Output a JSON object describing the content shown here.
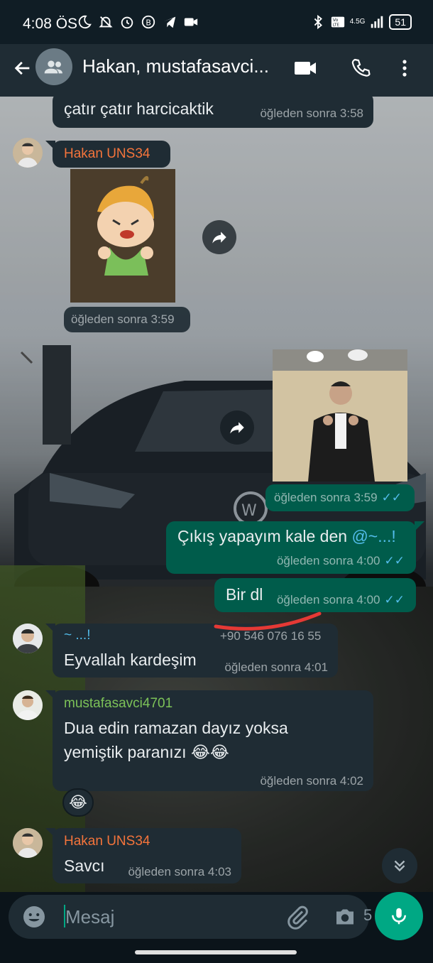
{
  "status_bar": {
    "time": "4:08 ÖS",
    "network": "4.5G",
    "battery": "51"
  },
  "header": {
    "title": "Hakan, mustafasavci..."
  },
  "messages": [
    {
      "id": "m0",
      "direction": "in",
      "text": "çatır çatır harcicaktik",
      "time": "öğleden sonra 3:58"
    },
    {
      "id": "m1",
      "direction": "in",
      "sender": "Hakan UNS34",
      "sender_color": "#f4743b",
      "type": "sticker",
      "time": "öğleden sonra 3:59"
    },
    {
      "id": "m2",
      "direction": "out",
      "type": "sticker",
      "time": "öğleden sonra 3:59",
      "read": true
    },
    {
      "id": "m3",
      "direction": "out",
      "text": "Çıkış yapayım kale den",
      "mention": "@~...!",
      "time": "öğleden sonra 4:00",
      "read": true
    },
    {
      "id": "m4",
      "direction": "out",
      "text": "Bir dl",
      "time": "öğleden sonra 4:00",
      "read": true
    },
    {
      "id": "m5",
      "direction": "in",
      "sender": "~ ...!",
      "sender_phone": "+90 546 076 16 55",
      "sender_color": "#53bdeb",
      "text": "Eyvallah kardeşim",
      "time": "öğleden sonra 4:01"
    },
    {
      "id": "m6",
      "direction": "in",
      "sender": "mustafasavci4701",
      "sender_color": "#7cc258",
      "text_line1": "Dua edin ramazan dayız yoksa",
      "text_line2": "yemiştik paranızı 😂😂",
      "time": "öğleden sonra 4:02",
      "reaction": "😂"
    },
    {
      "id": "m7",
      "direction": "in",
      "sender": "Hakan UNS34",
      "sender_color": "#f4743b",
      "text": "Savcı",
      "time": "öğleden sonra 4:03"
    }
  ],
  "input": {
    "placeholder": "Mesaj",
    "camera_badge": "5"
  },
  "colors": {
    "accent": "#00a884",
    "bubble_in": "#1f2c34",
    "bubble_out": "#005c4b",
    "read_ticks": "#53bdeb"
  }
}
